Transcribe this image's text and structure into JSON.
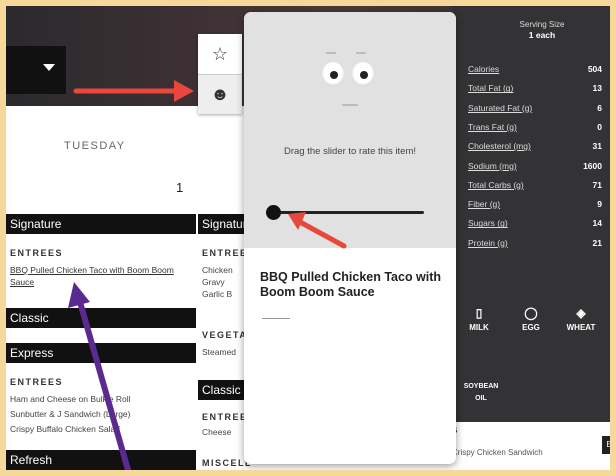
{
  "rail": {
    "favorite_icon": "star-outline-icon",
    "rate_icon": "smiley-face-icon"
  },
  "header": {
    "day": "TUESDAY",
    "date": "1"
  },
  "column1": {
    "signature": {
      "title": "Signature",
      "entrees_label": "ENTREES",
      "item": "BBQ Pulled Chicken Taco with Boom Boom Sauce"
    },
    "classic_title": "Classic",
    "express": {
      "title": "Express",
      "entrees_label": "ENTREES",
      "items": [
        "Ham and Cheese on Bulkie Roll",
        "Sunbutter & J Sandwich (Large)",
        "Crispy Buffalo Chicken Salad"
      ]
    },
    "refresh_title": "Refresh"
  },
  "column2": {
    "signature_title": "Signature",
    "entrees_label": "ENTREES",
    "items": [
      "Chicken",
      "Gravy",
      "Garlic B"
    ],
    "veg_label": "VEGETABLES",
    "veg_item": "Steamed",
    "classic_title": "Classic",
    "classic_entrees": "ENTREES",
    "classic_item": "Cheese",
    "misc_label": "MISCELLANEOUS"
  },
  "popup": {
    "prompt": "Drag the slider to rate this item!",
    "slider_value": 0,
    "title": "BBQ Pulled Chicken Taco with Boom Boom Sauce"
  },
  "nutrition": {
    "serving_label": "Serving Size",
    "serving_value": "1 each",
    "rows": [
      {
        "label": "Calories",
        "value": "504"
      },
      {
        "label": "Total Fat (g)",
        "value": "13"
      },
      {
        "label": "Saturated Fat (g)",
        "value": "6"
      },
      {
        "label": "Trans Fat (g)",
        "value": "0"
      },
      {
        "label": "Cholesterol (mg)",
        "value": "31"
      },
      {
        "label": "Sodium (mg)",
        "value": "1600"
      },
      {
        "label": "Total Carbs (g)",
        "value": "71"
      },
      {
        "label": "Fiber (g)",
        "value": "9"
      },
      {
        "label": "Sugars (g)",
        "value": "14"
      },
      {
        "label": "Protein (g)",
        "value": "21"
      }
    ],
    "allergens": [
      "MILK",
      "EGG",
      "WHEAT"
    ],
    "allergen_soy": "SOYBEAN OIL"
  },
  "below_nutrition": {
    "section_suffix": "S",
    "item": "Crispy Chicken Sandwich",
    "button": "Ex"
  },
  "colors": {
    "nutrition_bg": "#333234",
    "popup_top": "#e1e1e1",
    "arrow_red": "#e8473b",
    "arrow_purple": "#5b2a91"
  }
}
